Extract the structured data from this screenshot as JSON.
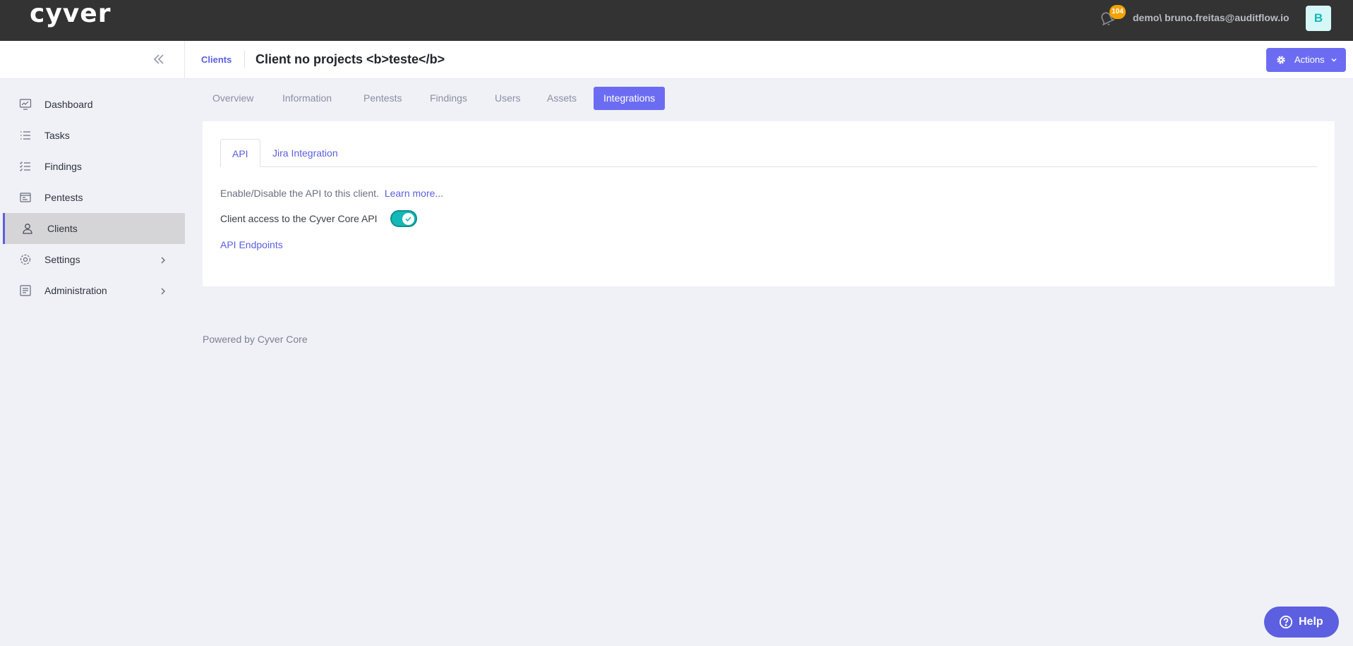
{
  "topbar": {
    "logo": "cyver",
    "notifications_count": "104",
    "user_text": "demo\\ bruno.freitas@auditflow.io",
    "avatar_letter": "B"
  },
  "header": {
    "breadcrumb": "Clients",
    "title": "Client no projects <b>teste</b>",
    "actions_label": "Actions"
  },
  "sidebar": {
    "items": [
      {
        "label": "Dashboard",
        "icon": "dashboard-icon"
      },
      {
        "label": "Tasks",
        "icon": "tasks-icon"
      },
      {
        "label": "Findings",
        "icon": "findings-icon"
      },
      {
        "label": "Pentests",
        "icon": "pentests-icon"
      },
      {
        "label": "Clients",
        "icon": "clients-icon",
        "active": true
      },
      {
        "label": "Settings",
        "icon": "settings-icon",
        "has_children": true
      },
      {
        "label": "Administration",
        "icon": "administration-icon",
        "has_children": true
      }
    ]
  },
  "tabs": [
    {
      "label": "Overview"
    },
    {
      "label": "Information"
    },
    {
      "label": "Pentests"
    },
    {
      "label": "Findings"
    },
    {
      "label": "Users"
    },
    {
      "label": "Assets"
    },
    {
      "label": "Integrations",
      "active": true
    }
  ],
  "card": {
    "subtabs": [
      {
        "label": "API",
        "active": true
      },
      {
        "label": "Jira Integration"
      }
    ],
    "description": "Enable/Disable the API to this client.",
    "learn_more": "Learn more...",
    "access_label": "Client access to the Cyver Core API",
    "access_enabled": true,
    "endpoints_link": "API Endpoints"
  },
  "footer": "Powered by Cyver Core",
  "help_label": "Help",
  "colors": {
    "accent": "#6c6cf3",
    "link": "#5b5fe0",
    "toggle_on": "#14b8b8",
    "badge": "#f4a300",
    "topbar": "#333333"
  }
}
